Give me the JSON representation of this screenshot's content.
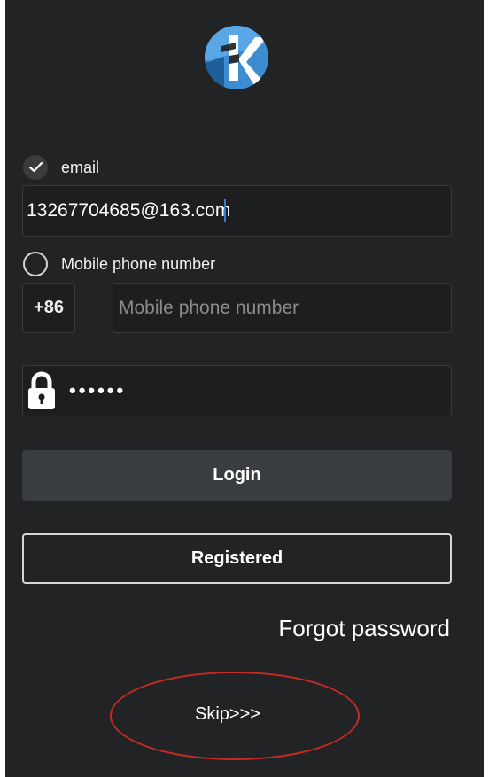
{
  "app": {
    "logo": "k-logo-icon"
  },
  "login_type": {
    "email_label": "email",
    "mobile_label": "Mobile phone number",
    "selected": "email"
  },
  "email": {
    "value": "13267704685@163.com"
  },
  "mobile": {
    "country_code": "+86",
    "placeholder": "Mobile phone number"
  },
  "password": {
    "masked_value": "••••••",
    "icon": "lock-icon"
  },
  "actions": {
    "login_label": "Login",
    "register_label": "Registered",
    "forgot_label": "Forgot password",
    "skip_label": "Skip>>>"
  },
  "colors": {
    "background": "#222324",
    "field_background": "#1d1e20",
    "login_button": "#393c40",
    "logo_blue": "#3d8bd1",
    "annotation_red": "#c62a25"
  }
}
